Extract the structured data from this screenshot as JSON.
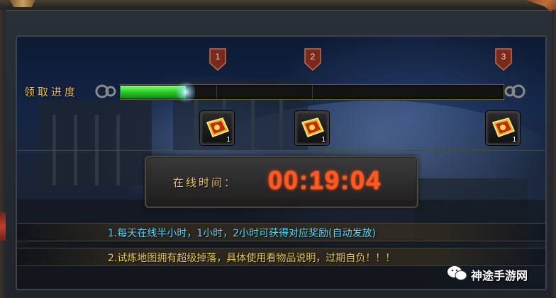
{
  "progress": {
    "label": "领取进度",
    "fill_fraction": 0.17,
    "milestones": [
      "1",
      "2",
      "3"
    ]
  },
  "rewards": [
    {
      "icon": "gold-token-icon",
      "count": "1"
    },
    {
      "icon": "gold-token-icon",
      "count": "1"
    },
    {
      "icon": "gold-token-icon",
      "count": "1"
    }
  ],
  "online_time": {
    "label": "在线时间：",
    "value": "00:19:04"
  },
  "notes": [
    "1.每天在线半小时，1小时，2小时可获得对应奖励(自动发放)",
    "2.试炼地图拥有超级掉落，具体使用看物品说明，过期自负！！！"
  ],
  "watermark": {
    "text": "神途手游网",
    "icon": "wechat-icon"
  },
  "colors": {
    "label_gold": "#e8c060",
    "timer_red": "#ff5a22",
    "note_cyan": "#5ed6ff",
    "progress_green": "#2ed12c"
  }
}
